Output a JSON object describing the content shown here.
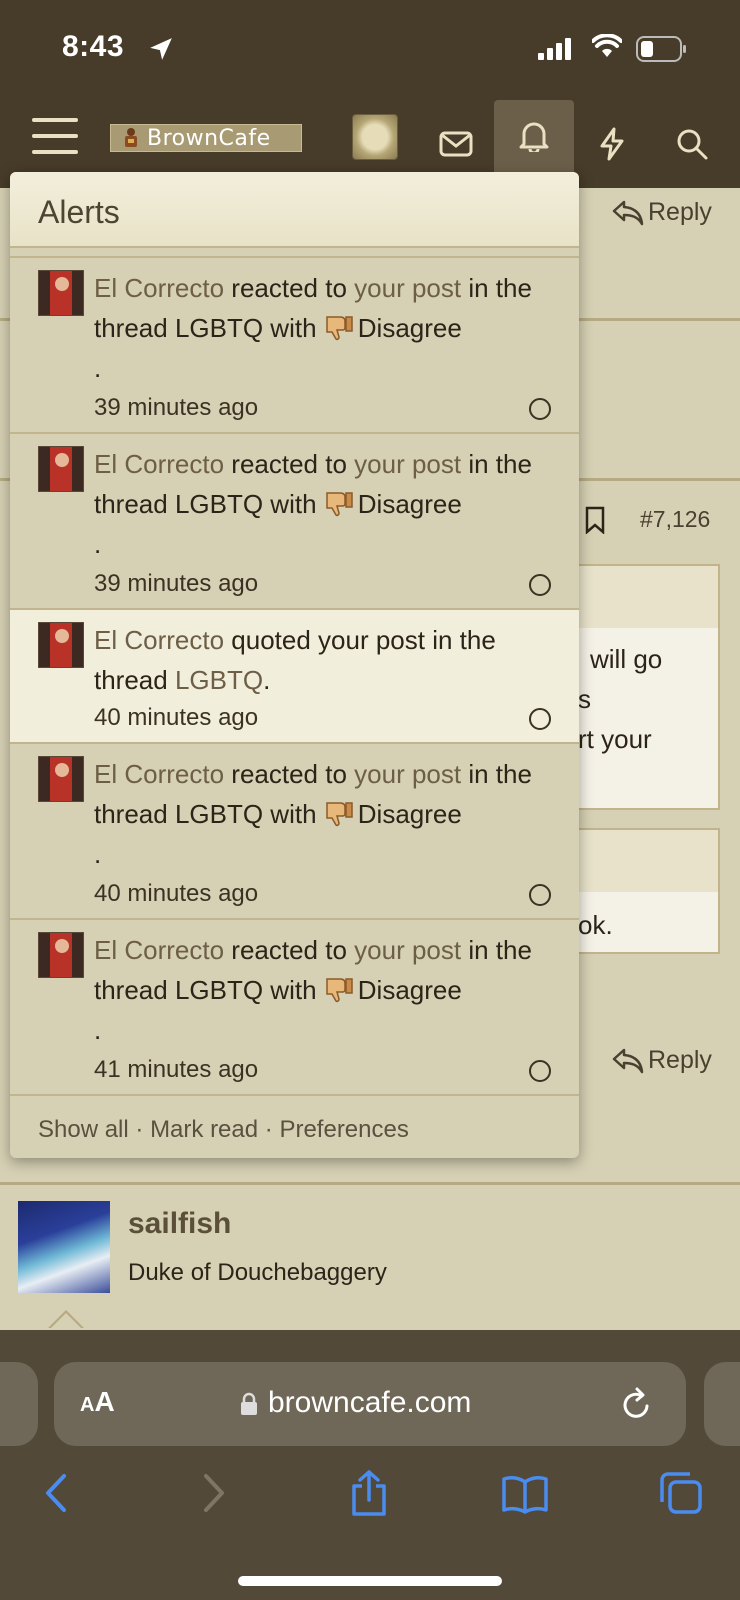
{
  "status": {
    "time": "8:43"
  },
  "nav": {
    "logo_text": "BrownCafe"
  },
  "background": {
    "reply_label": "Reply",
    "post_number": "#7,126",
    "fragment_1": "will go",
    "fragment_2": "s",
    "fragment_3": "rt your",
    "fragment_4": "ok."
  },
  "alerts": {
    "title": "Alerts",
    "items": [
      {
        "user": "El Correcto",
        "action": "reacted to",
        "target": "your post",
        "context": "in the thread LGBTQ with",
        "reaction": "Disagree",
        "trail": ".",
        "time": "39 minutes ago"
      },
      {
        "user": "El Correcto",
        "action": "reacted to",
        "target": "your post",
        "context": "in the thread LGBTQ with",
        "reaction": "Disagree",
        "trail": ".",
        "time": "39 minutes ago"
      },
      {
        "user": "El Correcto",
        "action": "quoted your post in the thread",
        "thread": "LGBTQ",
        "trail": ".",
        "time": "40 minutes ago"
      },
      {
        "user": "El Correcto",
        "action": "reacted to",
        "target": "your post",
        "context": "in the thread LGBTQ with",
        "reaction": "Disagree",
        "trail": ".",
        "time": "40 minutes ago"
      },
      {
        "user": "El Correcto",
        "action": "reacted to",
        "target": "your post",
        "context": "in the thread LGBTQ with",
        "reaction": "Disagree",
        "trail": ".",
        "time": "41 minutes ago"
      }
    ],
    "footer": {
      "show_all": "Show all",
      "sep": "·",
      "mark_read": "Mark read",
      "preferences": "Preferences"
    }
  },
  "user_block": {
    "name": "sailfish",
    "title": "Duke of Douchebaggery"
  },
  "safari": {
    "aa_small": "A",
    "aa_large": "A",
    "url": "browncafe.com"
  },
  "colors": {
    "header_bg": "#473b29",
    "page_bg": "#d6d0b4",
    "link": "#6d5f47",
    "safari_bg": "#524938",
    "accent_blue": "#4a8cf0"
  }
}
